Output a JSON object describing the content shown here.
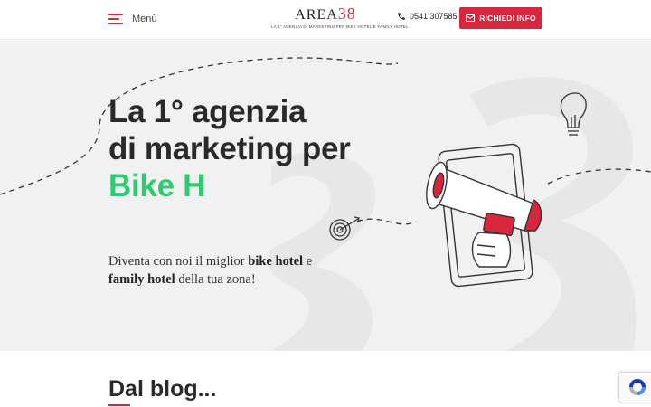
{
  "header": {
    "menu_label": "Menù",
    "logo": {
      "word": "AREA",
      "number": "38",
      "tagline": "LA 1° AGENZIA DI MARKETING PER BIKE HOTEL E FAMILY HOTEL"
    },
    "phone": "0541 307585",
    "cta_label": "RICHIEDI INFO"
  },
  "hero": {
    "title_line1": "La 1° agenzia",
    "title_line2": "di marketing per",
    "title_accent": "Bike H",
    "sub_part1": "Diventa con noi il miglior ",
    "sub_bold1": "bike hotel",
    "sub_part2": " e",
    "sub_bold2": "family hotel",
    "sub_part3": " della tua zona!"
  },
  "blog": {
    "title": "Dal blog..."
  },
  "colors": {
    "brand_red": "#d7263d",
    "accent_green": "#2ecc71",
    "hero_bg": "#f1f1f1"
  }
}
